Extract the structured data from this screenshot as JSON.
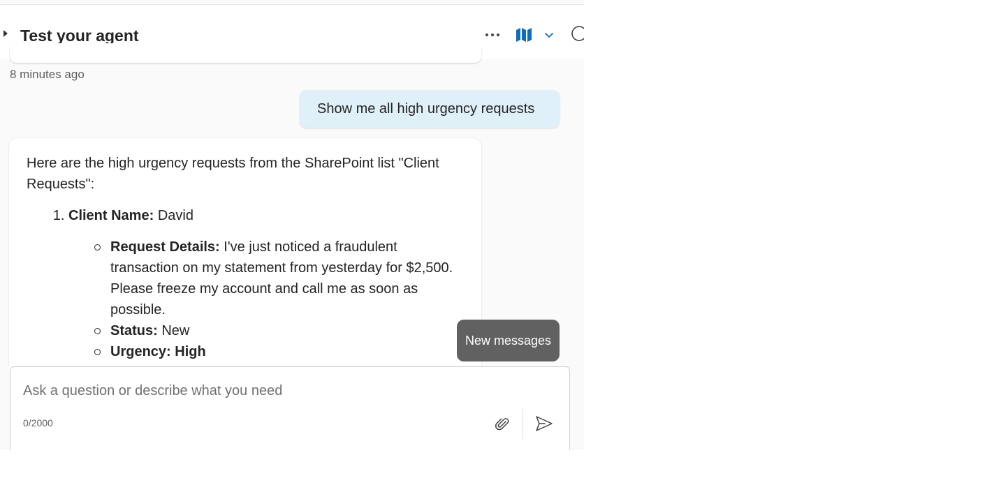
{
  "header": {
    "title": "Test your agent",
    "icons": [
      "expand-caret-icon",
      "more-options-icon",
      "map-icon",
      "chevron-down-icon",
      "refresh-icon"
    ],
    "accent_color": "#0f6cbd"
  },
  "conversation": {
    "timestamp": "8 minutes ago",
    "user_message": "Show me all high urgency requests",
    "bot_response": {
      "intro": "Here are the high urgency requests from the SharePoint list \"Client Requests\":",
      "item_number": "1.",
      "client_name_label": "Client Name:",
      "client_name_value": "David",
      "details": [
        {
          "label": "Request Details:",
          "value": "I've just noticed a fraudulent transaction on my statement from yesterday for $2,500. Please freeze my account and call me as soon as possible."
        },
        {
          "label": "Status:",
          "value": "New"
        },
        {
          "label": "Urgency: High",
          "value": ""
        }
      ]
    }
  },
  "new_messages_button": {
    "label": "New messages",
    "color": "#616161"
  },
  "composer": {
    "placeholder": "Ask a question or describe what you need",
    "value": "",
    "char_count": "0/2000",
    "icons": [
      "attach-icon",
      "send-icon"
    ]
  }
}
